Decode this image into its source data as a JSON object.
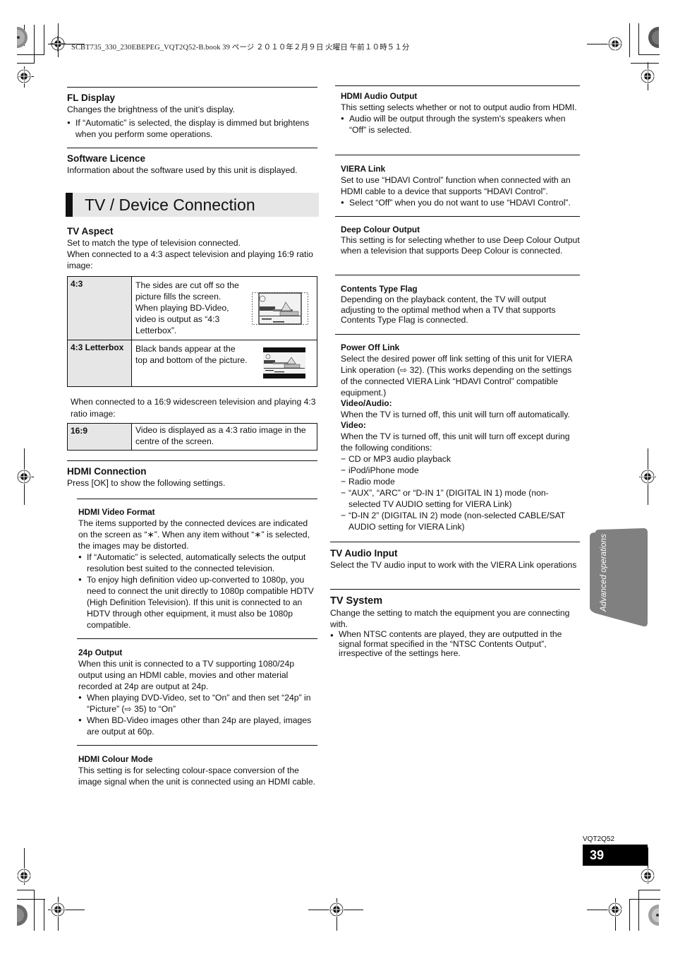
{
  "print_header": "SCBT735_330_230EBEPEG_VQT2Q52-B.book  39 ページ  ２０１０年２月９日  火曜日  午前１０時５１分",
  "left_column": {
    "fl_display": {
      "title": "FL Display",
      "text": "Changes the brightness of the unit’s display.",
      "bullets": [
        "If “Automatic” is selected, the display is dimmed but brightens when you perform some operations."
      ]
    },
    "software_licence": {
      "title": "Software Licence",
      "text": "Information about the software used by this unit is displayed."
    },
    "section_banner": "TV / Device Connection",
    "tv_aspect": {
      "title": "TV Aspect",
      "text1": "Set to match the type of television connected.",
      "text2": "When connected to a 4:3 aspect television and playing 16:9 ratio image:",
      "table1": [
        {
          "key": "4:3",
          "value": "The sides are cut off so the picture fills the screen. When playing BD-Video, video is output as “4:3 Letterbox”.",
          "image": "side-cut-tv-illustration"
        },
        {
          "key": "4:3 Letterbox",
          "value": "Black bands appear at the top and bottom of the picture.",
          "image": "letterbox-tv-illustration"
        }
      ],
      "text3": "When connected to a 16:9 widescreen television and playing 4:3 ratio image:",
      "table2": [
        {
          "key": "16:9",
          "value": "Video is displayed as a 4:3 ratio image in the centre of the screen."
        }
      ]
    },
    "hdmi_connection": {
      "title": "HDMI Connection",
      "text": "Press [OK] to show the following settings.",
      "video_format": {
        "title": "HDMI Video Format",
        "text": "The items supported by the connected devices are indicated on the screen as “∗”. When any item without “∗” is selected, the images may be distorted.",
        "bullets": [
          "If “Automatic” is selected, automatically selects the output resolution best suited to the connected television.",
          "To enjoy high definition video up-converted to 1080p, you need to connect the unit directly to 1080p compatible HDTV (High Definition Television). If this unit is connected to an HDTV through other equipment, it must also be 1080p compatible."
        ]
      },
      "output_24p": {
        "title": "24p Output",
        "text": "When this unit is connected to a TV supporting 1080/24p output using an HDMI cable, movies and other material recorded at 24p are output at 24p.",
        "bullets": [
          "When playing DVD-Video, set to “On” and then set “24p” in “Picture” (⇨ 35) to “On”",
          "When BD-Video images other than 24p are played, images are output at 60p."
        ]
      },
      "colour_mode": {
        "title": "HDMI Colour Mode",
        "text": "This setting is for selecting colour-space conversion of the image signal when the unit is connected using an HDMI cable."
      }
    }
  },
  "right_column": {
    "hdmi_audio_output": {
      "title": "HDMI Audio Output",
      "text": "This setting selects whether or not to output audio from HDMI.",
      "bullets": [
        "Audio will be output through the system's speakers when “Off” is selected."
      ]
    },
    "viera_link": {
      "title": "VIERA Link",
      "text": "Set to use “HDAVI Control” function when connected with an HDMI cable to a device that supports “HDAVI Control”.",
      "bullets": [
        "Select “Off” when you do not want to use “HDAVI Control”."
      ]
    },
    "deep_colour": {
      "title": "Deep Colour Output",
      "text": "This setting is for selecting whether to use Deep Colour Output when a television that supports Deep Colour is connected."
    },
    "contents_type_flag": {
      "title": "Contents Type Flag",
      "text": "Depending on the playback content, the TV will output adjusting to the optimal method when a TV that supports Contents Type Flag is connected."
    },
    "power_off_link": {
      "title": "Power Off Link",
      "text": "Select the desired power off link setting of this unit for VIERA Link operation (⇨ 32). (This works depending on the settings of the connected VIERA Link “HDAVI Control” compatible equipment.)",
      "video_audio_label": "Video/Audio:",
      "video_audio_text": "When the TV is turned off, this unit will turn off automatically.",
      "video_label": "Video:",
      "video_text": "When the TV is turned off, this unit will turn off except during the following conditions:",
      "conditions": [
        "CD or MP3 audio playback",
        "iPod/iPhone mode",
        "Radio mode",
        "“AUX”, “ARC” or “D-IN 1” (DIGITAL IN 1) mode (non-selected TV AUDIO setting for VIERA Link)",
        "“D-IN 2” (DIGITAL IN 2) mode (non-selected CABLE/SAT AUDIO setting for VIERA Link)"
      ]
    },
    "tv_audio_input": {
      "title": "TV Audio Input",
      "text": "Select the TV audio input to work with the VIERA Link operations"
    },
    "tv_system": {
      "title": "TV System",
      "text": "Change the setting to match the equipment you are connecting with.",
      "bullets": [
        "When NTSC contents are played, they are outputted in the signal format specified in the “NTSC Contents Output”, irrespective of the settings here."
      ]
    }
  },
  "side_tab": "Advanced operations",
  "footer": {
    "doc_number": "VQT2Q52",
    "page_number": "39"
  },
  "colors": {
    "banner_bg": "#e6e6e6",
    "table_key_bg": "#e6e6e6",
    "side_tab_bg": "#808080",
    "page_box_bg": "#000000"
  }
}
